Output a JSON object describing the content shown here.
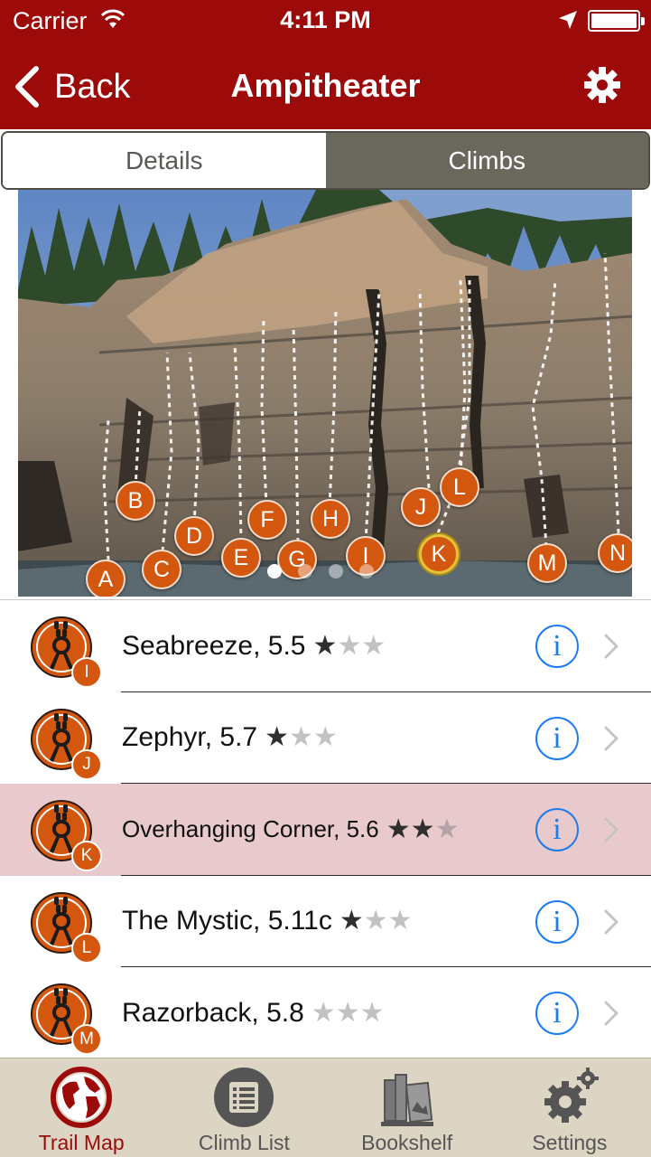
{
  "status_bar": {
    "carrier": "Carrier",
    "time": "4:11 PM"
  },
  "nav": {
    "back_label": "Back",
    "title": "Ampitheater",
    "settings_icon": "gear-icon"
  },
  "segments": {
    "items": [
      "Details",
      "Climbs"
    ],
    "selected": "Climbs"
  },
  "photo": {
    "markers": [
      "A",
      "B",
      "C",
      "D",
      "E",
      "F",
      "G",
      "H",
      "I",
      "J",
      "K",
      "L",
      "M",
      "N"
    ],
    "selected_marker": "K",
    "page_count": 4,
    "current_page": 1
  },
  "climbs": [
    {
      "label": "Seabreeze, 5.5",
      "stars": 1,
      "badge": "I"
    },
    {
      "label": "Zephyr, 5.7",
      "stars": 1,
      "badge": "J"
    },
    {
      "label": "Overhanging Corner, 5.6",
      "stars": 2,
      "badge": "K",
      "selected": true
    },
    {
      "label": "The Mystic, 5.11c",
      "stars": 1,
      "badge": "L"
    },
    {
      "label": "Razorback, 5.8",
      "stars": 0,
      "badge": "M"
    }
  ],
  "tab_bar": {
    "items": [
      {
        "label": "Trail Map",
        "icon": "globe-icon",
        "active": true
      },
      {
        "label": "Climb List",
        "icon": "list-icon",
        "active": false
      },
      {
        "label": "Bookshelf",
        "icon": "books-icon",
        "active": false
      },
      {
        "label": "Settings",
        "icon": "gears-icon",
        "active": false
      }
    ]
  },
  "colors": {
    "header": "#9c0a0a",
    "marker": "#d4570f",
    "info": "#1b7cf0",
    "selected_row": "#e8cacc",
    "tab_bar": "#ddd5c3"
  }
}
